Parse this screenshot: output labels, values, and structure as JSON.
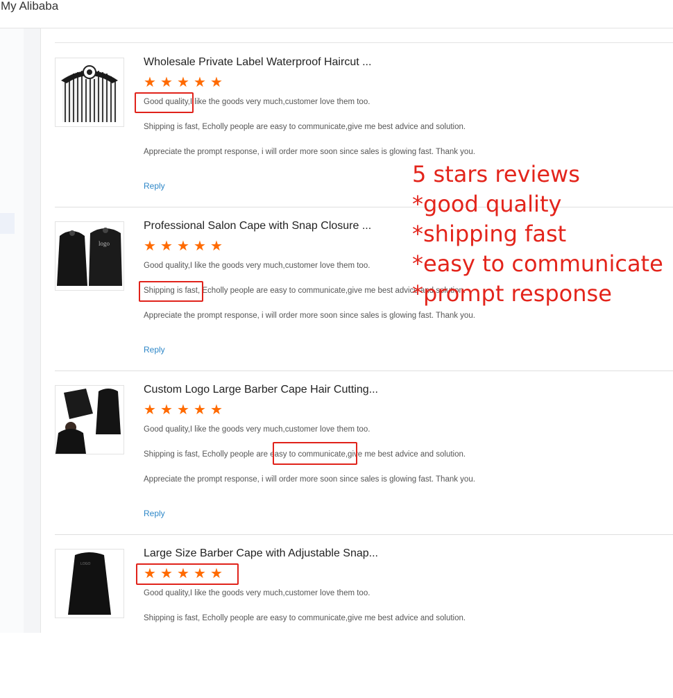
{
  "header": {
    "title": "My Alibaba"
  },
  "reviews": [
    {
      "title": "Wholesale Private Label Waterproof Haircut ...",
      "image_icon": "striped-barber-cape",
      "stars": 5,
      "line1": "Good quality,I like the goods very much,customer love them too.",
      "line2": "Shipping is fast, Echolly people are easy to communicate,give me best advice and solution.",
      "line3": "Appreciate the prompt response, i will order more soon since sales is glowing fast. Thank you.",
      "reply": "Reply"
    },
    {
      "title": "Professional Salon Cape with Snap Closure ...",
      "image_icon": "black-cape-with-logo",
      "stars": 5,
      "line1": "Good quality,I like the goods very much,customer love them too.",
      "line2": "Shipping is fast, Echolly people are easy to communicate,give me best advice and solution.",
      "line3": "Appreciate the prompt response, i will order more soon since sales is glowing fast. Thank you.",
      "reply": "Reply"
    },
    {
      "title": "Custom Logo Large Barber Cape Hair Cutting...",
      "image_icon": "black-barber-cape-set",
      "stars": 5,
      "line1": "Good quality,I like the goods very much,customer love them too.",
      "line2": "Shipping is fast, Echolly people are easy to communicate,give me best advice and solution.",
      "line3": "Appreciate the prompt response, i will order more soon since sales is glowing fast. Thank you.",
      "reply": "Reply"
    },
    {
      "title": "Large Size Barber Cape with Adjustable Snap...",
      "image_icon": "large-black-cape",
      "stars": 5,
      "line1": "Good quality,I like the goods very much,customer love them too.",
      "line2": "Shipping is fast, Echolly people are easy to communicate,give me best advice and solution."
    }
  ],
  "annotation": {
    "lines": [
      "5 stars reviews",
      "*good quality",
      "*shipping fast",
      "*easy to communicate",
      "*prompt response"
    ],
    "color": "#e3241b"
  },
  "colors": {
    "star": "#ff6a00",
    "link": "#2e87c8",
    "highlight": "#e0221a"
  }
}
